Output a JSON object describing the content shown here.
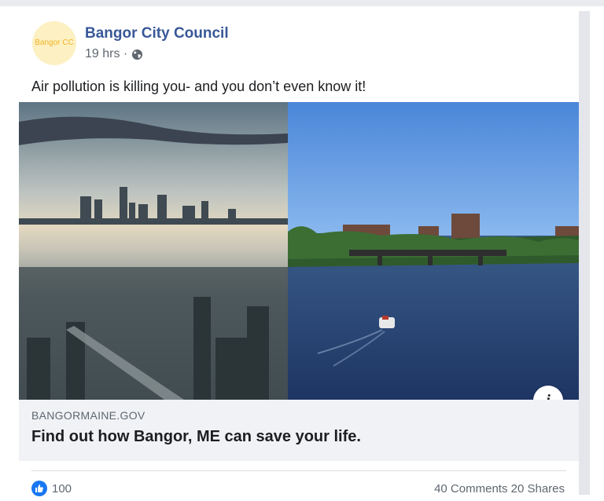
{
  "post": {
    "page_name": "Bangor City Council",
    "avatar_text": "Bangor CC",
    "timestamp": "19 hrs ·",
    "privacy_icon": "globe-icon",
    "text": "Air pollution is killing you- and you don’t even know it!"
  },
  "media": {
    "info_label": "i"
  },
  "link_preview": {
    "domain": "BANGORMAINE.GOV",
    "headline": "Find out how Bangor, ME can save your life."
  },
  "footer": {
    "reaction_count": "100",
    "comments_shares": "40 Comments  20 Shares"
  },
  "colors": {
    "link_blue": "#385898",
    "like_blue": "#1877f2",
    "avatar_bg": "#fdf0c2",
    "avatar_text": "#f0b429"
  }
}
